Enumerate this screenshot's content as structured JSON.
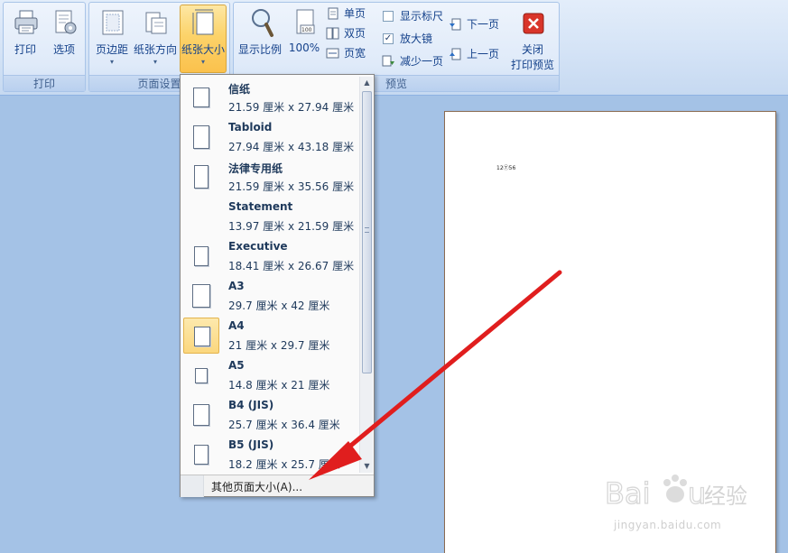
{
  "ribbon": {
    "groups": {
      "print": {
        "label": "打印",
        "buttons": {
          "print": "打印",
          "options": "选项"
        }
      },
      "page_setup": {
        "label": "页面设置",
        "buttons": {
          "margins": "页边距",
          "orientation": "纸张方向",
          "size": "纸张大小"
        }
      },
      "preview": {
        "label": "预览",
        "buttons": {
          "zoom": "显示比例",
          "hundred": "100%",
          "hundred_icon_text": "100",
          "one_page": "单页",
          "two_pages": "双页",
          "page_width": "页宽",
          "show_ruler": "显示标尺",
          "magnifier": "放大镜",
          "shrink_one_page": "减少一页",
          "next_page": "下一页",
          "prev_page": "上一页",
          "close_line1": "关闭",
          "close_line2": "打印预览"
        },
        "checkboxes": {
          "show_ruler": false,
          "magnifier": true
        }
      }
    }
  },
  "paper_size_menu": {
    "items": [
      {
        "name": "信纸",
        "size": "21.59 厘米 x 27.94 厘米"
      },
      {
        "name": "Tabloid",
        "size": "27.94 厘米 x 43.18 厘米"
      },
      {
        "name": "法律专用纸",
        "size": "21.59 厘米 x 35.56 厘米"
      },
      {
        "name": "Statement",
        "size": "13.97 厘米 x 21.59 厘米"
      },
      {
        "name": "Executive",
        "size": "18.41 厘米 x 26.67 厘米"
      },
      {
        "name": "A3",
        "size": "29.7 厘米 x 42 厘米"
      },
      {
        "name": "A4",
        "size": "21 厘米 x 29.7 厘米",
        "selected": true
      },
      {
        "name": "A5",
        "size": "14.8 厘米 x 21 厘米"
      },
      {
        "name": "B4 (JIS)",
        "size": "25.7 厘米 x 36.4 厘米"
      },
      {
        "name": "B5 (JIS)",
        "size": "18.2 厘米 x 25.7 厘米"
      }
    ],
    "more_sizes": "其他页面大小(A)..."
  },
  "document": {
    "text": "12Ⓣ56"
  },
  "watermark": {
    "logo_text": "Baidu经验",
    "url": "jingyan.baidu.com"
  },
  "colors": {
    "ribbon_bg": "#dfeaf9",
    "active_button": "#fbc14c",
    "workspace": "#a4c2e6",
    "annotation_arrow": "#e01e1e",
    "close_button": "#d9352a"
  }
}
